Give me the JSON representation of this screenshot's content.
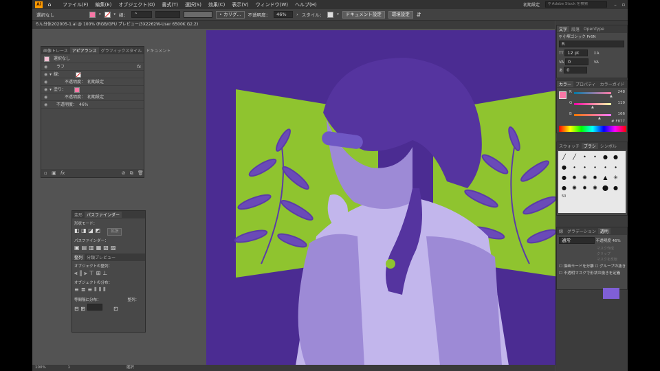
{
  "app": {
    "logo": "Ai",
    "home_icon": "home-icon"
  },
  "menu": [
    "ファイル(F)",
    "編集(E)",
    "オブジェクト(O)",
    "書式(T)",
    "選択(S)",
    "効果(C)",
    "表示(V)",
    "ウィンドウ(W)",
    "ヘルプ(H)"
  ],
  "top_right": {
    "workspace": "初期設定",
    "search_placeholder": "Adobe Stock を検索"
  },
  "control": {
    "selection": "選択なし",
    "stroke_label": "線：",
    "brush": "カリグ...",
    "opacity_label": "不透明度：",
    "opacity_value": "46%",
    "style_label": "スタイル：",
    "doc_setup": "ドキュメント設定",
    "env_setup": "環境設定"
  },
  "doc_tab": "らん分体202005-1.ai @ 100% (RGB/GPU プレビュー/3X2262W-User 6500K G2.2)",
  "appearance": {
    "tabs": [
      "画像トレース",
      "アピアランス",
      "グラフィックスタイル",
      "ドキュメント"
    ],
    "title": "選択なし",
    "rows": [
      {
        "label": "ラフ",
        "indent": 0
      },
      {
        "label": "線：",
        "indent": 1
      },
      {
        "label": "不透明度：　初期設定",
        "indent": 2
      },
      {
        "label": "塗り：",
        "indent": 1
      },
      {
        "label": "不透明度：　初期設定",
        "indent": 2
      },
      {
        "label": "不透明度：　46%",
        "indent": 1
      }
    ]
  },
  "pathfinder": {
    "tabs": [
      "変形",
      "パスファインダー"
    ],
    "shape_mode": "形状モード：",
    "expand": "拡張",
    "pathfinders": "パスファインダー：",
    "align_tabs": [
      "整列",
      "分類プレビュー"
    ],
    "align_objects": "オブジェクトの整列：",
    "distribute_objects": "オブジェクトの分布：",
    "distribute_spacing": "等間隔に分布：",
    "align_to": "整列："
  },
  "character": {
    "tabs": [
      "文字",
      "段落",
      "OpenType"
    ],
    "font": "小塚ゴシック Pr6N",
    "style": "R",
    "size": "12 pt",
    "tracking": "0",
    "leading": "0"
  },
  "color": {
    "tabs": [
      "カラー",
      "プロパティ",
      "カラーガイド"
    ],
    "r": 248,
    "g": 119,
    "b": 166,
    "hex": "F877",
    "fill": "#f877a6",
    "r_fraction": 0.97,
    "g_fraction": 0.47,
    "b_fraction": 0.65
  },
  "brushes": {
    "tabs": [
      "スウォッチ",
      "ブラシ",
      "シンボル"
    ],
    "size_label": "50"
  },
  "transparency": {
    "tabs": [
      "線",
      "グラデーション",
      "透明"
    ],
    "mode": "通常",
    "opacity_label": "不透明度",
    "opacity_value": "46%",
    "options": [
      "描画モードを分離",
      "グループの抜き",
      "不透明マスクで形状の抜きを定義"
    ],
    "mask_buttons": [
      "マスク作成",
      "クリップ",
      "マスクを反転"
    ],
    "swatch_color": "#7f5fd6"
  },
  "status": {
    "zoom": "100%",
    "page": "1",
    "tool": "選択"
  },
  "art": {
    "bg": "#4b2c92",
    "lime": "#8fc42f",
    "hair": "#55349f",
    "skin": "#9d8ad6",
    "light": "#c2b6ec",
    "leaf": "#6a4ab8"
  }
}
